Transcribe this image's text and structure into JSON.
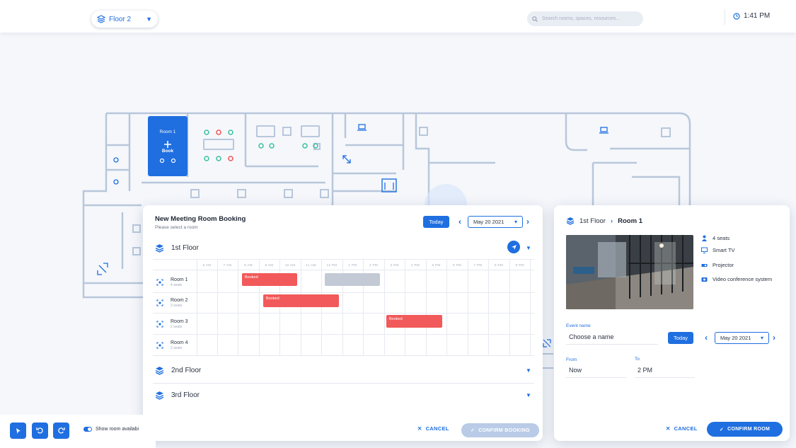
{
  "header": {
    "floor_selector": "Floor 2",
    "search_placeholder": "Search rooms, spaces, resources...",
    "time": "1:41 PM"
  },
  "floor_plan": {
    "selected_room_label": "Room 1",
    "selected_room_action": "Book"
  },
  "booking_modal": {
    "title": "New Meeting Room Booking",
    "subtitle": "Please select a room",
    "today_label": "Today",
    "date": "May 20 2021",
    "floors": [
      "1st Floor",
      "2nd Floor",
      "3rd Floor"
    ],
    "time_slots": [
      "6 AM",
      "7 AM",
      "8 AM",
      "9 AM",
      "10 AM",
      "11 AM",
      "12 PM",
      "1 PM",
      "2 PM",
      "3 PM",
      "4 PM",
      "5 PM",
      "6 PM",
      "7 PM",
      "8 PM",
      "9 PM"
    ],
    "rooms": [
      {
        "name": "Room 1",
        "seats": "4 seats"
      },
      {
        "name": "Room 2",
        "seats": "3 seats"
      },
      {
        "name": "Room 3",
        "seats": "2 seats"
      },
      {
        "name": "Room 4",
        "seats": "2 seats"
      }
    ],
    "booked_label": "Booked",
    "cancel_label": "CANCEL",
    "confirm_label": "CONFIRM BOOKING"
  },
  "room_panel": {
    "floor": "1st Floor",
    "room": "Room 1",
    "amenities": [
      "4 seats",
      "Smart TV",
      "Projector",
      "Video conference system"
    ],
    "event_name_label": "Event name",
    "event_name_value": "Choose a name",
    "today_label": "Today",
    "date": "May 20 2021",
    "from_label": "From",
    "from_value": "Now",
    "to_label": "To",
    "to_value": "2 PM",
    "cancel_label": "CANCEL",
    "confirm_label": "CONFIRM ROOM"
  },
  "bottom_bar": {
    "toggle_label": "Show room availabi"
  },
  "colors": {
    "accent": "#1f6fe0",
    "booked": "#f2595a",
    "pending": "#c3cad6",
    "wall": "#b8c7db"
  }
}
